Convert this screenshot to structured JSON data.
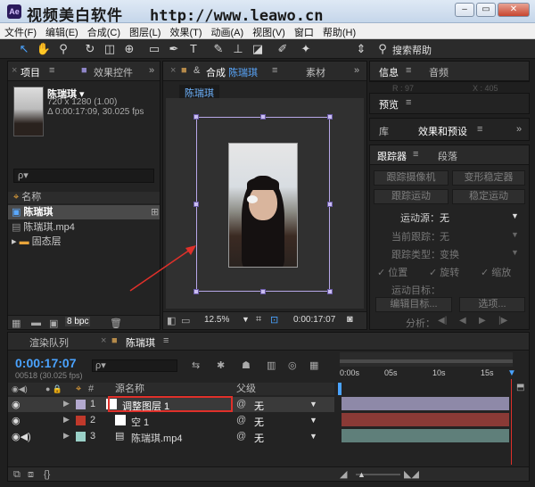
{
  "watermark": {
    "title": "视频美白软件",
    "url": "http://www.leawo.cn"
  },
  "window_buttons": {
    "minimize": "–",
    "restore": "▭",
    "close": "✕"
  },
  "menubar": [
    "文件(F)",
    "编辑(E)",
    "合成(C)",
    "图层(L)",
    "效果(T)",
    "动画(A)",
    "视图(V)",
    "窗口",
    "帮助(H)"
  ],
  "toolbar": {
    "search_help": "搜索帮助"
  },
  "project_panel": {
    "tab_project": "项目",
    "tab_effects_controls": "效果控件",
    "item_name": "陈瑞琪 ▾",
    "item_res": "720 x 1280 (1.00)",
    "item_duration": "Δ 0:00:17:09, 30.025 fps",
    "search_placeholder": "ρ▾",
    "col_name": "名称",
    "items": [
      "陈瑞琪",
      "陈瑞琪.mp4",
      "固态层"
    ],
    "bpc": "8 bpc"
  },
  "comp_panel": {
    "tab_label": "合成",
    "comp_name": "陈瑞琪",
    "tab_material": "素材",
    "breadcrumb": "陈瑞琪",
    "zoom": "12.5%",
    "timecode": "0:00:17:07"
  },
  "right_panels": {
    "tab_info": "信息",
    "tab_audio": "音频",
    "info_r": "R : 97",
    "info_x": "X : 405",
    "tab_preview": "预览",
    "tab_library": "库",
    "tab_effects_presets": "效果和预设",
    "tab_tracker": "跟踪器",
    "tab_paragraph": "段落",
    "btn_track_camera": "跟踪摄像机",
    "btn_warp_stabilize": "变形稳定器",
    "btn_track_motion": "跟踪运动",
    "btn_stabilize_motion": "稳定运动",
    "motion_source_label": "运动源：",
    "motion_source_value": "无",
    "current_track_label": "当前跟踪：",
    "current_track_value": "无",
    "track_type_label": "跟踪类型：",
    "track_type_value": "变换",
    "chk_position": "位置",
    "chk_rotation": "旋转",
    "chk_scale": "缩放",
    "motion_target_label": "运动目标：",
    "btn_edit_target": "编辑目标...",
    "btn_options": "选项...",
    "analyze_label": "分析："
  },
  "timeline": {
    "tab_render_queue": "渲染队列",
    "tab_comp": "陈瑞琪",
    "timecode": "0:00:17:07",
    "frame_info": "00518 (30.025 fps)",
    "col_source_name": "源名称",
    "col_parent": "父级",
    "ruler": [
      "0:00s",
      "05s",
      "10s",
      "15s"
    ],
    "layers": [
      {
        "num": "1",
        "name": "调整图层 1",
        "parent": "无",
        "color": "#b3a9cf"
      },
      {
        "num": "2",
        "name": "空 1",
        "parent": "无",
        "color": "#c0392b"
      },
      {
        "num": "3",
        "name": "陈瑞琪.mp4",
        "parent": "无",
        "color": "#9ad0c7"
      }
    ]
  },
  "colors": {
    "accent_blue": "#4aa3ff",
    "highlight_red": "#e0302a",
    "crop_lilac": "#b7a7e8"
  }
}
